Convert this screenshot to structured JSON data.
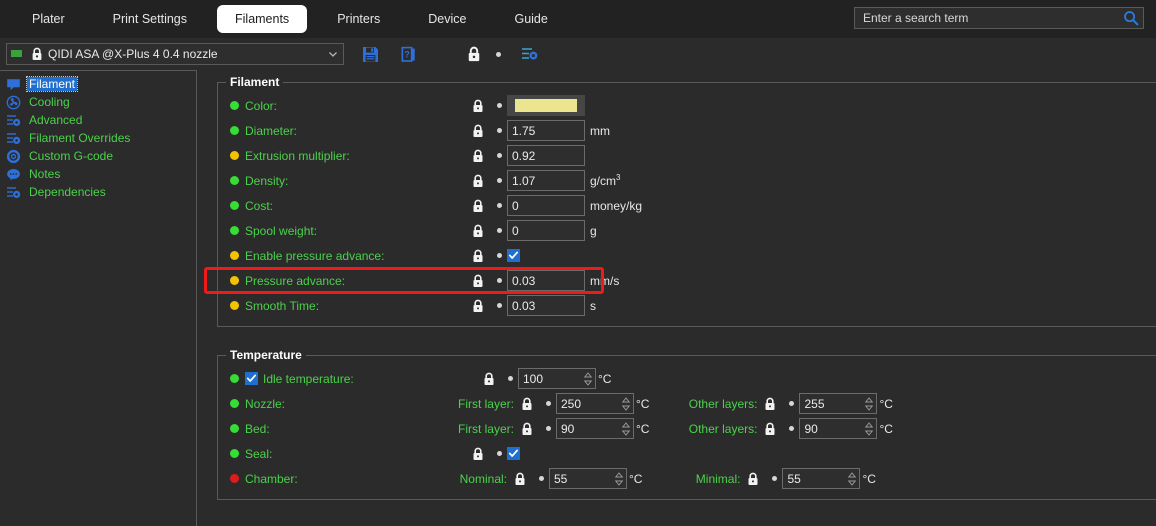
{
  "window": {
    "tabs": [
      {
        "label": "Plater",
        "active": false
      },
      {
        "label": "Print Settings",
        "active": false
      },
      {
        "label": "Filaments",
        "active": true
      },
      {
        "label": "Printers",
        "active": false
      },
      {
        "label": "Device",
        "active": false
      },
      {
        "label": "Guide",
        "active": false
      }
    ],
    "search": {
      "placeholder": "Enter a search term",
      "icon": "search-icon"
    }
  },
  "preset_bar": {
    "preset_name": "QIDI ASA @X-Plus 4 0.4 nozzle",
    "flag_icon": "flag-icon",
    "lock_icon": "lock-closed-icon",
    "dropdown_icon": "chevron-down-icon",
    "buttons": [
      {
        "name": "save-preset-button",
        "icon": "floppy-disk-icon"
      },
      {
        "name": "compare-preset-button",
        "icon": "question-document-icon"
      },
      {
        "name": "lock-toggle-button",
        "icon": "lock-closed-icon"
      },
      {
        "name": "revert-dot-button",
        "icon": "dot-icon"
      },
      {
        "name": "preset-settings-button",
        "icon": "sliders-gear-icon"
      }
    ]
  },
  "sidebar": {
    "items": [
      {
        "label": "Filament",
        "icon": "speech-bubble-icon",
        "active": true
      },
      {
        "label": "Cooling",
        "icon": "fan-icon",
        "active": false
      },
      {
        "label": "Advanced",
        "icon": "sliders-gear-icon",
        "active": false
      },
      {
        "label": "Filament Overrides",
        "icon": "sliders-gear-icon",
        "active": false
      },
      {
        "label": "Custom G-code",
        "icon": "gear-icon",
        "active": false
      },
      {
        "label": "Notes",
        "icon": "notes-bubble-icon",
        "active": false
      },
      {
        "label": "Dependencies",
        "icon": "sliders-gear-icon",
        "active": false
      }
    ]
  },
  "colors": {
    "accent_blue": "#1f6fd0",
    "label_green": "#4ad24a",
    "bullet_green": "#35dd35",
    "bullet_orange": "#f2c300",
    "bullet_red": "#e01b1b",
    "highlight_red": "#f01a1a",
    "filament_color_swatch": "#ece58f",
    "background": "#2b2b2b"
  },
  "filament_group": {
    "title": "Filament",
    "rows": [
      {
        "label": "Color:",
        "bullet": "green",
        "control": "color",
        "value": "#ece58f",
        "unit": ""
      },
      {
        "label": "Diameter:",
        "bullet": "green",
        "control": "text",
        "value": "1.75",
        "unit": "mm"
      },
      {
        "label": "Extrusion multiplier:",
        "bullet": "orange",
        "control": "text",
        "value": "0.92",
        "unit": ""
      },
      {
        "label": "Density:",
        "bullet": "green",
        "control": "text",
        "value": "1.07",
        "unit": "g/cm3"
      },
      {
        "label": "Cost:",
        "bullet": "green",
        "control": "text",
        "value": "0",
        "unit": "money/kg"
      },
      {
        "label": "Spool weight:",
        "bullet": "green",
        "control": "text",
        "value": "0",
        "unit": "g"
      },
      {
        "label": "Enable pressure advance:",
        "bullet": "orange",
        "control": "checkbox",
        "value": "checked",
        "unit": ""
      },
      {
        "label": "Pressure advance:",
        "bullet": "orange",
        "control": "text",
        "value": "0.03",
        "unit": "mm/s",
        "highlighted": true
      },
      {
        "label": "Smooth Time:",
        "bullet": "orange",
        "control": "text",
        "value": "0.03",
        "unit": "s"
      }
    ]
  },
  "temperature_group": {
    "title": "Temperature",
    "rows": [
      {
        "label": "Idle temperature:",
        "bullet": "green",
        "inline_checkbox": true,
        "left": {
          "sublabel": "",
          "value": "100",
          "unit": "°C",
          "control": "spin"
        },
        "right": null
      },
      {
        "label": "Nozzle:",
        "bullet": "green",
        "inline_checkbox": false,
        "left": {
          "sublabel": "First layer:",
          "value": "250",
          "unit": "°C",
          "control": "spin"
        },
        "right": {
          "sublabel": "Other layers:",
          "value": "255",
          "unit": "°C",
          "control": "spin"
        }
      },
      {
        "label": "Bed:",
        "bullet": "green",
        "inline_checkbox": false,
        "left": {
          "sublabel": "First layer:",
          "value": "90",
          "unit": "°C",
          "control": "spin"
        },
        "right": {
          "sublabel": "Other layers:",
          "value": "90",
          "unit": "°C",
          "control": "spin"
        }
      },
      {
        "label": "Seal:",
        "bullet": "green",
        "inline_checkbox": false,
        "left": {
          "sublabel": "",
          "value": "checked",
          "unit": "",
          "control": "checkbox"
        },
        "right": null
      },
      {
        "label": "Chamber:",
        "bullet": "red",
        "inline_checkbox": false,
        "left": {
          "sublabel": "Nominal:",
          "value": "55",
          "unit": "°C",
          "control": "spin"
        },
        "right": {
          "sublabel": "Minimal:",
          "value": "55",
          "unit": "°C",
          "control": "spin"
        }
      }
    ]
  }
}
